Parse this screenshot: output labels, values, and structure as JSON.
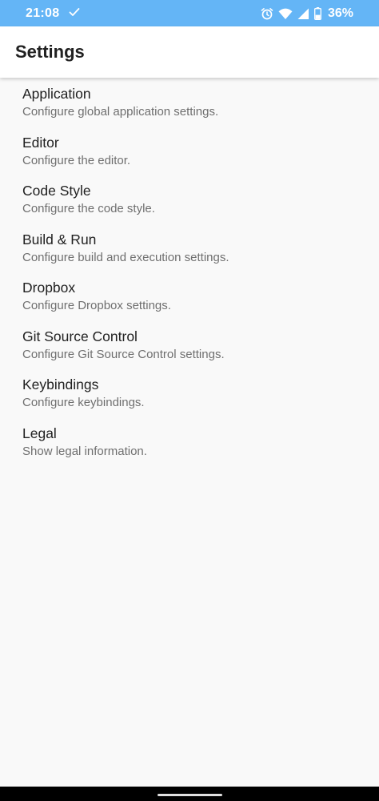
{
  "status_bar": {
    "time": "21:08",
    "battery": "36%",
    "icons": [
      "check-icon",
      "alarm-icon",
      "wifi-icon",
      "signal-icon",
      "battery-icon"
    ],
    "background_color": "#64b5f6"
  },
  "app_bar": {
    "title": "Settings"
  },
  "settings": {
    "items": [
      {
        "title": "Application",
        "summary": "Configure global application settings."
      },
      {
        "title": "Editor",
        "summary": "Configure the editor."
      },
      {
        "title": "Code Style",
        "summary": "Configure the code style."
      },
      {
        "title": "Build & Run",
        "summary": "Configure build and execution settings."
      },
      {
        "title": "Dropbox",
        "summary": "Configure Dropbox settings."
      },
      {
        "title": "Git Source Control",
        "summary": "Configure Git Source Control settings."
      },
      {
        "title": "Keybindings",
        "summary": "Configure keybindings."
      },
      {
        "title": "Legal",
        "summary": "Show legal information."
      }
    ]
  }
}
